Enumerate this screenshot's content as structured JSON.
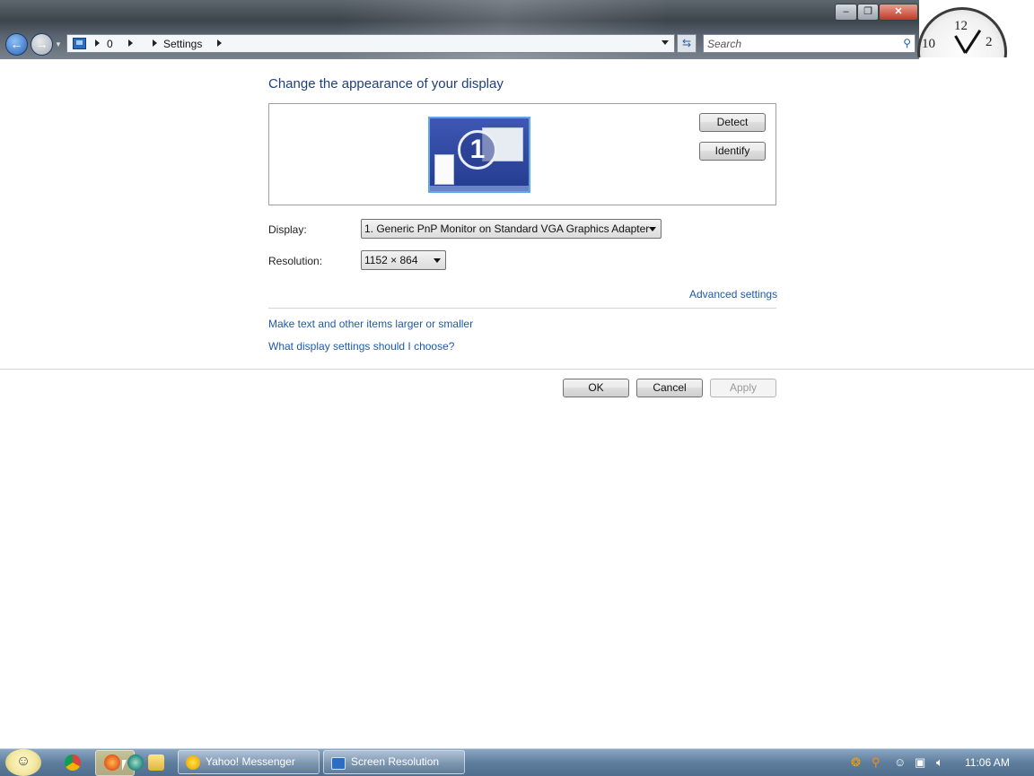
{
  "window": {
    "minimize_icon": "minimize-icon",
    "maximize_icon": "restore-icon",
    "close_icon": "close-icon"
  },
  "nav": {
    "breadcrumb": [
      "0",
      "Settings"
    ],
    "search_placeholder": "Search"
  },
  "clock_gadget": {
    "numbers": [
      "12",
      "2",
      "10"
    ]
  },
  "main": {
    "title": "Change the appearance of your display",
    "monitor_number": "1",
    "detect_label": "Detect",
    "identify_label": "Identify",
    "display_label": "Display:",
    "display_value": "1. Generic PnP Monitor on Standard VGA Graphics Adapter",
    "resolution_label": "Resolution:",
    "resolution_value": "1152 × 864",
    "advanced_link": "Advanced settings",
    "link_text_size": "Make text and other items larger or smaller",
    "link_help": "What display settings should I choose?",
    "ok_label": "OK",
    "cancel_label": "Cancel",
    "apply_label": "Apply"
  },
  "taskbar": {
    "tasks": [
      {
        "label": "Yahoo! Messenger",
        "icon": "yahoo-messenger-icon"
      },
      {
        "label": "Screen Resolution",
        "icon": "display-icon"
      }
    ],
    "time": "11:06 AM"
  },
  "colors": {
    "title": "#1e3f7a",
    "link": "#1e5aa8",
    "taskbar": "#5f7e9e"
  }
}
